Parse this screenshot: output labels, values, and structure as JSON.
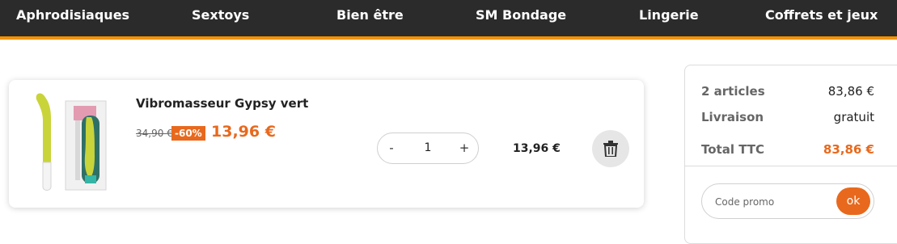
{
  "nav": {
    "items": [
      {
        "label": "Aphrodisiaques"
      },
      {
        "label": "Sextoys"
      },
      {
        "label": "Bien être"
      },
      {
        "label": "SM Bondage"
      },
      {
        "label": "Lingerie"
      },
      {
        "label": "Coffrets et jeux"
      }
    ]
  },
  "cart_item": {
    "name": "Vibromasseur Gypsy vert",
    "old_price": "34,90 €",
    "discount": "-60%",
    "price": "13,96 €",
    "quantity": "1",
    "minus": "-",
    "plus": "+",
    "line_total": "13,96 €",
    "image_icon": "product-image"
  },
  "summary": {
    "articles_label": "2 articles",
    "articles_value": "83,86 €",
    "delivery_label": "Livraison",
    "delivery_value": "gratuit",
    "total_label": "Total TTC",
    "total_value": "83,86 €",
    "promo_placeholder": "Code promo",
    "promo_button": "ok"
  },
  "colors": {
    "accent": "#e8691d",
    "nav_bg": "#2b2b2b",
    "nav_border": "#f39200"
  }
}
